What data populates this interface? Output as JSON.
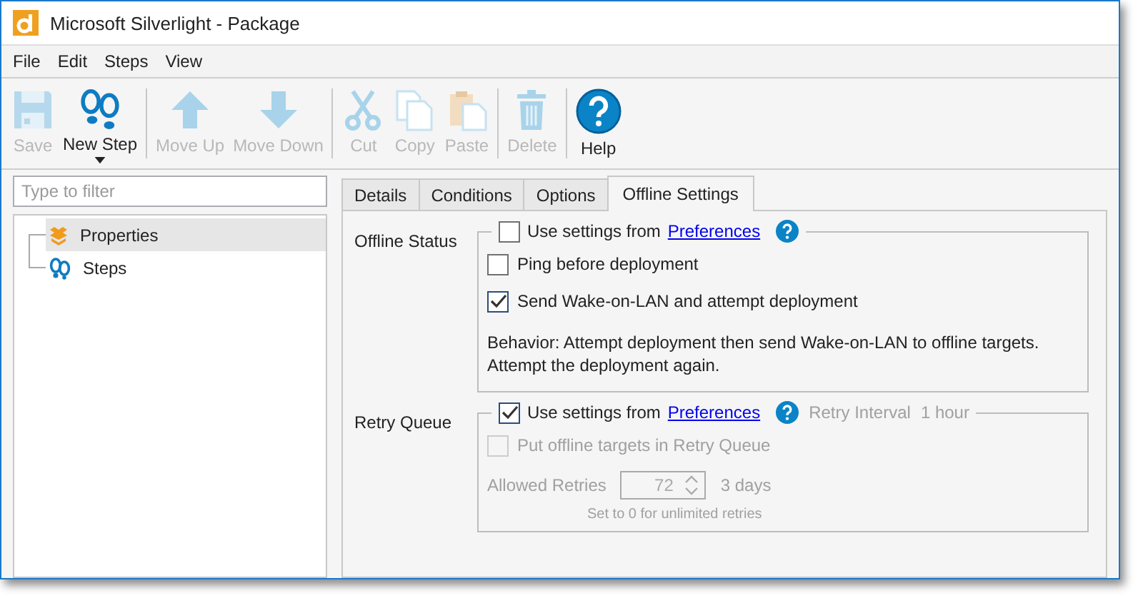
{
  "window": {
    "title": "Microsoft Silverlight - Package"
  },
  "menu": [
    "File",
    "Edit",
    "Steps",
    "View"
  ],
  "toolbar_groups": [
    [
      {
        "label": "Save",
        "kind": "save",
        "disabled": true
      },
      {
        "label": "New Step",
        "kind": "new-step",
        "disabled": false,
        "dropdown": true
      }
    ],
    [
      {
        "label": "Move Up",
        "kind": "up",
        "disabled": true
      },
      {
        "label": "Move Down",
        "kind": "down",
        "disabled": true
      }
    ],
    [
      {
        "label": "Cut",
        "kind": "cut",
        "disabled": true
      },
      {
        "label": "Copy",
        "kind": "copy",
        "disabled": true
      },
      {
        "label": "Paste",
        "kind": "paste",
        "disabled": true
      }
    ],
    [
      {
        "label": "Delete",
        "kind": "delete",
        "disabled": true
      }
    ],
    [
      {
        "label": "Help",
        "kind": "help",
        "disabled": false
      }
    ]
  ],
  "filter": {
    "placeholder": "Type to filter"
  },
  "tree": [
    {
      "label": "Properties",
      "kind": "properties",
      "selected": true
    },
    {
      "label": "Steps",
      "kind": "steps",
      "selected": false
    }
  ],
  "tabs": [
    {
      "label": "Details",
      "selected": false
    },
    {
      "label": "Conditions",
      "selected": false
    },
    {
      "label": "Options",
      "selected": false
    },
    {
      "label": "Offline Settings",
      "selected": true
    }
  ],
  "offline_status": {
    "label": "Offline Status",
    "use_settings": {
      "text": "Use settings from",
      "link": "Preferences",
      "checked": false
    },
    "options": [
      {
        "label": "Ping before deployment",
        "checked": false
      },
      {
        "label": "Send Wake-on-LAN and attempt deployment",
        "checked": true
      }
    ],
    "behavior": "Behavior: Attempt deployment then send Wake-on-LAN to offline targets.\nAttempt the deployment again."
  },
  "retry_queue": {
    "label": "Retry Queue",
    "use_settings": {
      "text": "Use settings from",
      "link": "Preferences",
      "checked": true
    },
    "interval_label": "Retry Interval",
    "interval_value": "1 hour",
    "disabled": true,
    "put_offline": {
      "label": "Put offline targets in Retry Queue",
      "checked": false
    },
    "allowed_retries": {
      "label": "Allowed Retries",
      "value": "72",
      "duration": "3 days"
    },
    "hint": "Set to 0 for unlimited retries"
  }
}
